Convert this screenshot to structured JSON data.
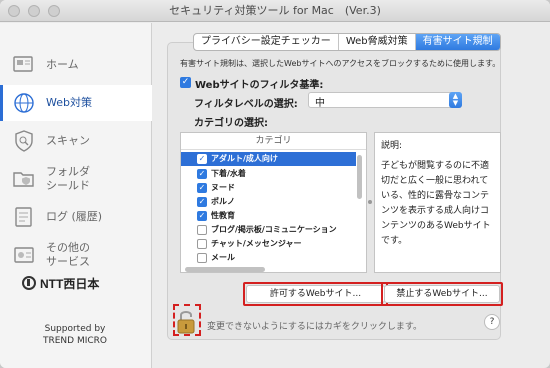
{
  "window": {
    "title": "セキュリティ対策ツール for Mac　(Ver.3)"
  },
  "sidebar": {
    "items": [
      {
        "label": "ホーム",
        "icon": "home-icon",
        "active": false
      },
      {
        "label": "Web対策",
        "icon": "globe-icon",
        "active": true
      },
      {
        "label": "スキャン",
        "icon": "shield-scan-icon",
        "active": false
      },
      {
        "label": "フォルダ\nシールド",
        "icon": "folder-shield-icon",
        "active": false
      },
      {
        "label": "ログ (履歴)",
        "icon": "log-icon",
        "active": false
      },
      {
        "label": "その他の\nサービス",
        "icon": "services-icon",
        "active": false
      }
    ],
    "logo_text": "NTT西日本",
    "supported_line1": "Supported by",
    "supported_line2": "TREND MICRO"
  },
  "tabs": [
    {
      "label": "プライバシー設定チェッカー",
      "active": false
    },
    {
      "label": "Web脅威対策",
      "active": false
    },
    {
      "label": "有害サイト規制",
      "active": true
    }
  ],
  "main": {
    "description": "有害サイト規制は、選択したWebサイトへのアクセスをブロックするために使用します。",
    "filter_checkbox_label": "Webサイトのフィルタ基準:",
    "filter_checked": true,
    "level_label": "フィルタレベルの選択:",
    "level_value": "中",
    "category_label": "カテゴリの選択:",
    "category_header": "カテゴリ",
    "categories": [
      {
        "name": "アダルト/成人向け",
        "checked": true,
        "selected": true
      },
      {
        "name": "下着/水着",
        "checked": true,
        "selected": false
      },
      {
        "name": "ヌード",
        "checked": true,
        "selected": false
      },
      {
        "name": "ポルノ",
        "checked": true,
        "selected": false
      },
      {
        "name": "性教育",
        "checked": true,
        "selected": false
      },
      {
        "name": "ブログ/掲示板/コミュニケーション",
        "checked": false,
        "selected": false
      },
      {
        "name": "チャット/メッセンジャー",
        "checked": false,
        "selected": false
      },
      {
        "name": "メール",
        "checked": false,
        "selected": false
      }
    ],
    "info_title": "説明:",
    "info_body": "子どもが閲覧するのに不適\n切だと広く一般に思われて\nいる、性的に露骨なコンテ\nンツを表示する成人向けコ\nンテンツのあるWebサイト\nです。",
    "allow_button": "許可するWebサイト...",
    "block_button": "禁止するWebサイト...",
    "lock_text": "変更できないようにするにはカギをクリックします。",
    "help_label": "?"
  },
  "colors": {
    "accent": "#2f7ae0",
    "highlight_frame": "#d42020",
    "selected_row": "#2d6fd6"
  }
}
